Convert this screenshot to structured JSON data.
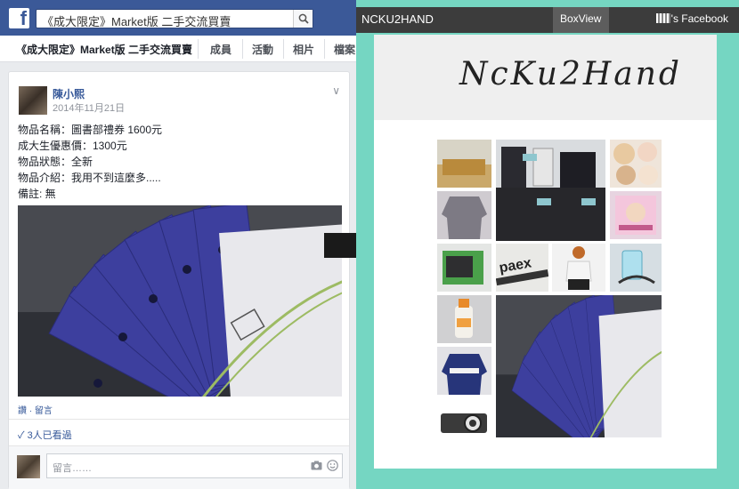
{
  "facebook": {
    "search_text": "《成大限定》Market版 二手交流買賣",
    "group_name": "《成大限定》Market版 二手交流買賣",
    "tabs": [
      "成員",
      "活動",
      "相片",
      "檔案"
    ],
    "post": {
      "author": "陳小熙",
      "date": "2014年11月21日",
      "lines": [
        "物品名稱：圖書部禮券 1600元",
        "成大生優惠價：1300元",
        "物品狀態：全新",
        "物品介紹：我用不到這麼多.....",
        "備註: 無"
      ],
      "actions": "讚 · 留言",
      "seen": "✓ 3人已看過",
      "comment_placeholder": "留言……"
    }
  },
  "ncku": {
    "brand": "NCKU2HAND",
    "boxview": "BoxView",
    "facebook_link": "'s Facebook",
    "title": "NcKu2Hand"
  },
  "colors": {
    "fb_blue": "#3b5998",
    "ncku_bg": "#75d6c2",
    "ncku_bar": "#3c3c3c"
  }
}
